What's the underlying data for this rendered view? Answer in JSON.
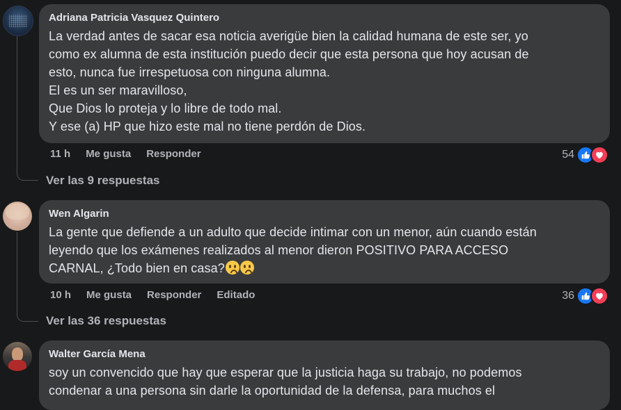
{
  "comments": [
    {
      "author": "Adriana Patricia Vasquez Quintero",
      "lines": [
        "La verdad antes de sacar esa noticia averigüe bien la calidad humana de este ser, yo",
        "como ex alumna de esta institución puedo decir que esta persona que hoy acusan de",
        "esto, nunca fue irrespetuosa con ninguna alumna.",
        "El es un ser maravilloso,",
        "Que Dios lo proteja y lo libre de todo mal.",
        "Y ese (a) HP que hizo este mal no tiene perdón de Dios."
      ],
      "time": "11 h",
      "like_label": "Me gusta",
      "reply_label": "Responder",
      "reaction_count": "54",
      "replies_link": "Ver las 9 respuestas"
    },
    {
      "author": "Wen Algarin",
      "lines": [
        "La gente que defiende a un adulto que decide intimar con un menor, aún cuando están",
        "leyendo que los exámenes realizados al menor dieron POSITIVO PARA ACCESO",
        "CARNAL, ¿Todo bien en casa?"
      ],
      "time": "10 h",
      "like_label": "Me gusta",
      "reply_label": "Responder",
      "edited_label": "Editado",
      "reaction_count": "36",
      "replies_link": "Ver las 36 respuestas"
    },
    {
      "author": "Walter García Mena",
      "lines": [
        "soy un convencido que hay que esperar que la justicia haga su trabajo, no podemos",
        "condenar a una persona sin darle la oportunidad de la defensa, para muchos el"
      ]
    }
  ],
  "colors": {
    "background": "#18191a",
    "bubble": "#3a3b3c",
    "text": "#e4e6eb",
    "muted": "#b0b3b8",
    "like_blue": "#1877f2",
    "love_red": "#f33e58"
  }
}
